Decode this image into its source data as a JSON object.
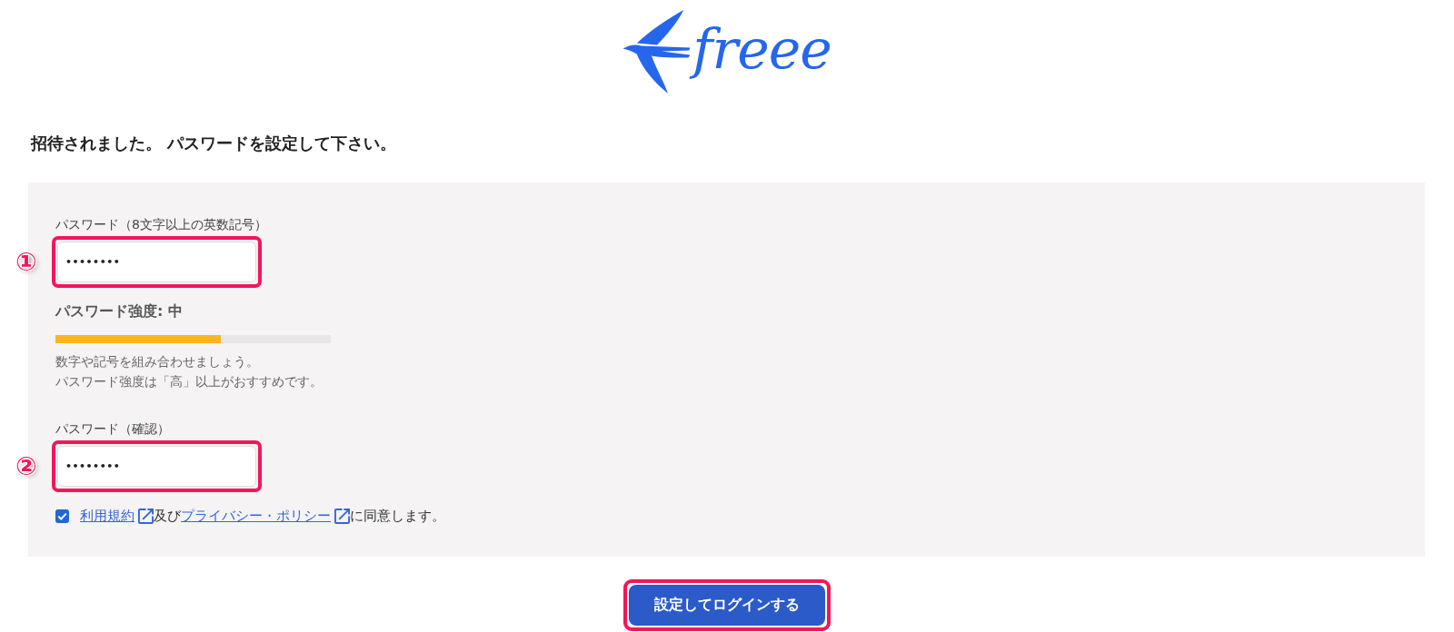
{
  "logo": {
    "wordmark": "freee"
  },
  "heading": "招待されました。 パスワードを設定して下さい。",
  "form": {
    "password": {
      "label": "パスワード（8文字以上の英数記号）",
      "value": "••••••••",
      "highlighted": true,
      "marker": "①"
    },
    "strength": {
      "label": "パスワード強度: 中",
      "level": 0.6,
      "hints": [
        "数字や記号を組み合わせましょう。",
        "パスワード強度は「高」以上がおすすめです。"
      ]
    },
    "confirm": {
      "label": "パスワード（確認）",
      "value": "••••••••",
      "highlighted": true,
      "marker": "②"
    },
    "agreement": {
      "checked": true,
      "parts": [
        {
          "kind": "link",
          "text": "利用規約"
        },
        {
          "kind": "text",
          "text": "及び"
        },
        {
          "kind": "link",
          "text": "プライバシー・ポリシー"
        },
        {
          "kind": "text",
          "text": "に同意します。"
        }
      ]
    }
  },
  "submit": {
    "label": "設定してログインする",
    "highlighted": true
  }
}
